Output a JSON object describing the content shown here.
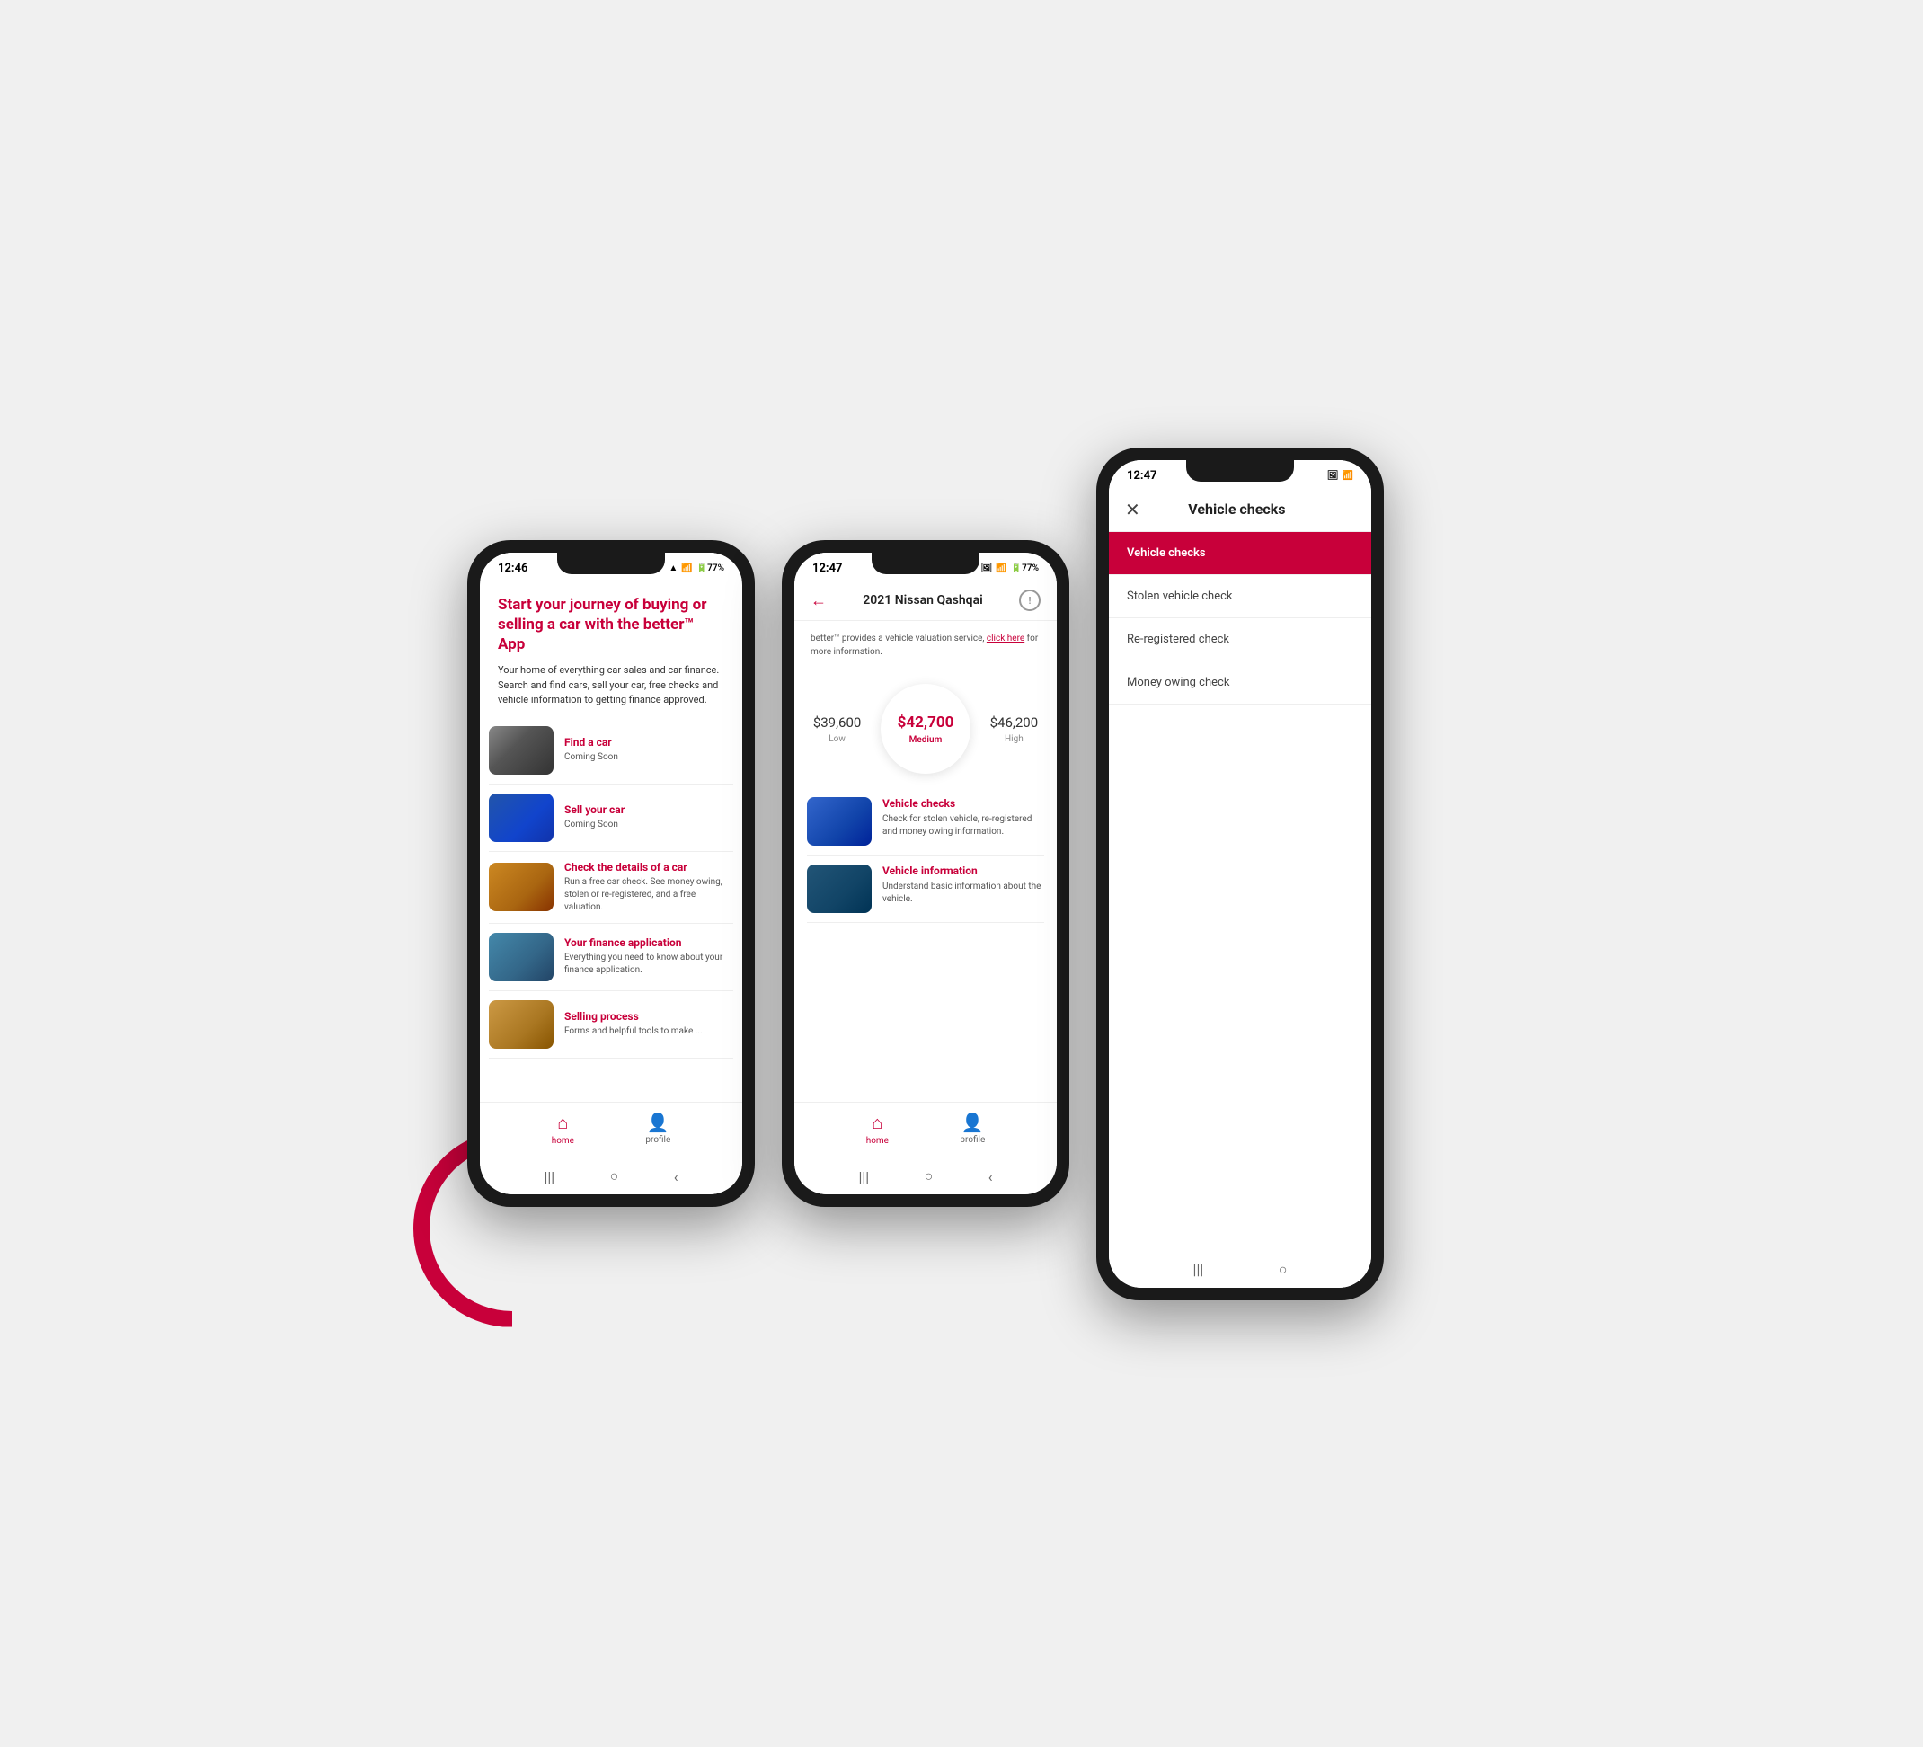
{
  "scene": {
    "phones": [
      {
        "id": "phone1",
        "statusBar": {
          "time": "12:46",
          "icons": "▲● 77%▪"
        },
        "header": {
          "title": "Start your journey of buying or selling a car with the better™ App",
          "subtitle": "Your home of everything car sales and car finance. Search and find cars, sell your car, free checks and vehicle information to getting finance approved."
        },
        "menuItems": [
          {
            "label": "Find a car",
            "description": "Coming Soon",
            "imgClass": "img-car1"
          },
          {
            "label": "Sell your car",
            "description": "Coming Soon",
            "imgClass": "img-car2"
          },
          {
            "label": "Check the details of a car",
            "description": "Run a free car check. See money owing, stolen or re-registered, and a free valuation.",
            "imgClass": "img-car3"
          },
          {
            "label": "Your finance application",
            "description": "Everything you need to know about your finance application.",
            "imgClass": "img-car4"
          },
          {
            "label": "Selling process",
            "description": "Forms and helpful tools to make ...",
            "imgClass": "img-car5"
          }
        ],
        "bottomNav": [
          {
            "icon": "⌂",
            "label": "home",
            "active": true
          },
          {
            "icon": "○",
            "label": "profile",
            "active": false
          }
        ],
        "androidBar": [
          "|||",
          "○",
          "‹"
        ]
      },
      {
        "id": "phone2",
        "statusBar": {
          "time": "12:47",
          "icons": "▲● 77%▪"
        },
        "navTitle": "2021 Nissan Qashqai",
        "banner": "better™ provides a vehicle valuation service,",
        "bannerLink": "click here",
        "bannerSuffix": "for more information.",
        "valuation": {
          "low": {
            "price": "$39,600",
            "label": "Low"
          },
          "medium": {
            "price": "$42,700",
            "label": "Medium"
          },
          "high": {
            "price": "$46,200",
            "label": "High"
          }
        },
        "features": [
          {
            "title": "Vehicle checks",
            "description": "Check for stolen vehicle, re-registered and money owing information.",
            "imgClass": "img-vehicle1"
          },
          {
            "title": "Vehicle information",
            "description": "Understand basic information about the vehicle.",
            "imgClass": "img-vehicle2"
          }
        ],
        "bottomNav": [
          {
            "icon": "⌂",
            "label": "home",
            "active": true
          },
          {
            "icon": "○",
            "label": "profile",
            "active": false
          }
        ],
        "androidBar": [
          "|||",
          "○",
          "‹"
        ]
      },
      {
        "id": "phone3",
        "statusBar": {
          "time": "12:47",
          "icons": "▲●"
        },
        "headerTitle": "Vehicle checks",
        "checkItems": [
          {
            "label": "Vehicle checks",
            "active": true
          },
          {
            "label": "Stolen vehicle check",
            "active": false
          },
          {
            "label": "Re-registered check",
            "active": false
          },
          {
            "label": "Money owing check",
            "active": false
          }
        ],
        "androidBar": [
          "|||",
          "○"
        ]
      }
    ]
  }
}
